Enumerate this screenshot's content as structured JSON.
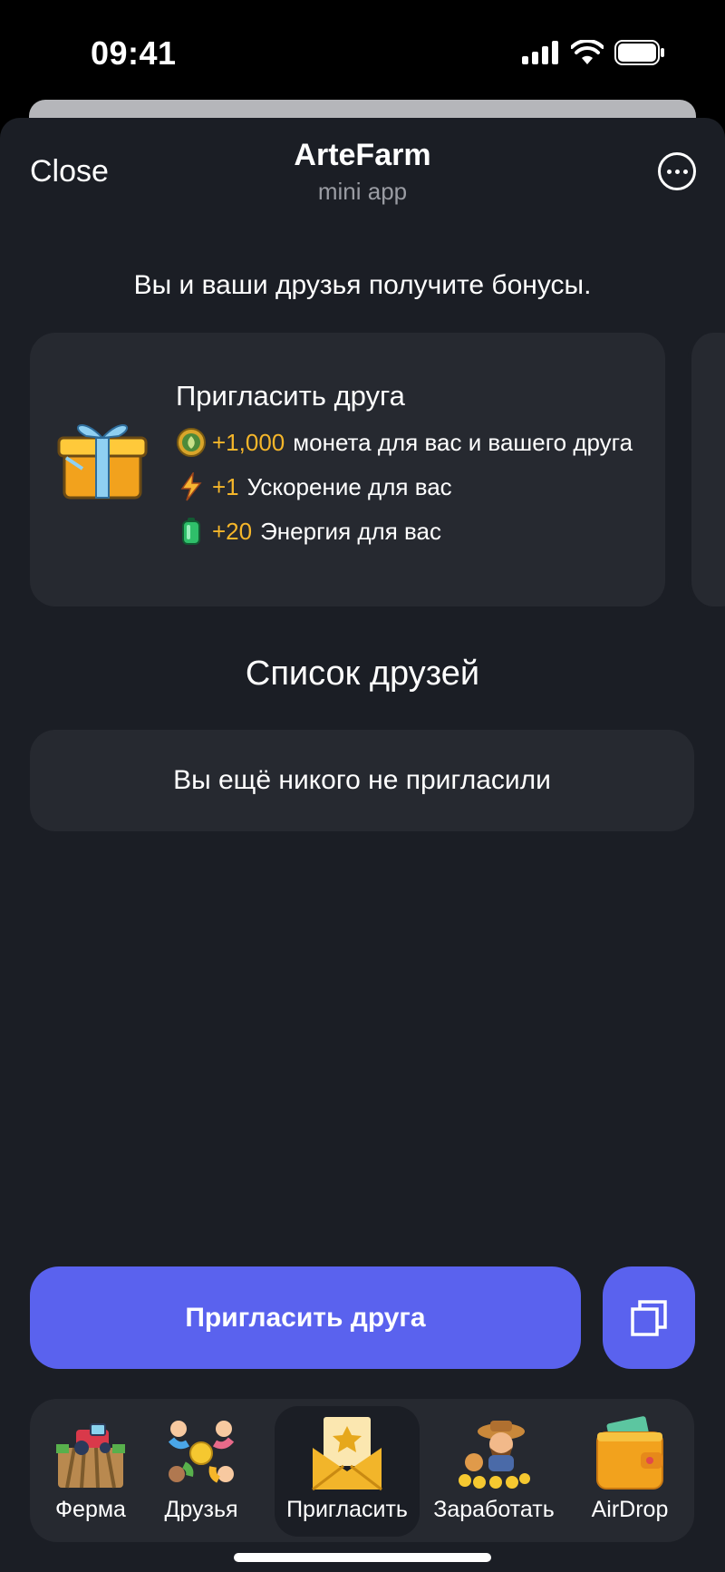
{
  "status_bar": {
    "time": "09:41"
  },
  "header": {
    "close_label": "Close",
    "title": "ArteFarm",
    "subtitle": "mini app"
  },
  "intro_text": "Вы и ваши друзья получите бонусы.",
  "invite_card": {
    "title": "Пригласить друга",
    "rows": [
      {
        "icon": "coin-icon",
        "amount": "+1,000",
        "text": "монета для вас и вашего друга"
      },
      {
        "icon": "lightning-icon",
        "amount": "+1",
        "text": "Ускорение для вас"
      },
      {
        "icon": "battery-icon",
        "amount": "+20",
        "text": "Энергия для вас"
      }
    ]
  },
  "friends": {
    "title": "Список друзей",
    "empty_text": "Вы ещё никого не пригласили"
  },
  "actions": {
    "invite_label": "Пригласить друга"
  },
  "tabs": [
    {
      "label": "Ферма",
      "icon": "farm-icon"
    },
    {
      "label": "Друзья",
      "icon": "friends-icon"
    },
    {
      "label": "Пригласить",
      "icon": "envelope-icon",
      "active": true
    },
    {
      "label": "Заработать",
      "icon": "farmer-icon"
    },
    {
      "label": "AirDrop",
      "icon": "wallet-icon"
    }
  ],
  "colors": {
    "accent": "#5a62ee",
    "amount": "#f5b62a",
    "background": "#1b1e25",
    "card": "#262930"
  }
}
